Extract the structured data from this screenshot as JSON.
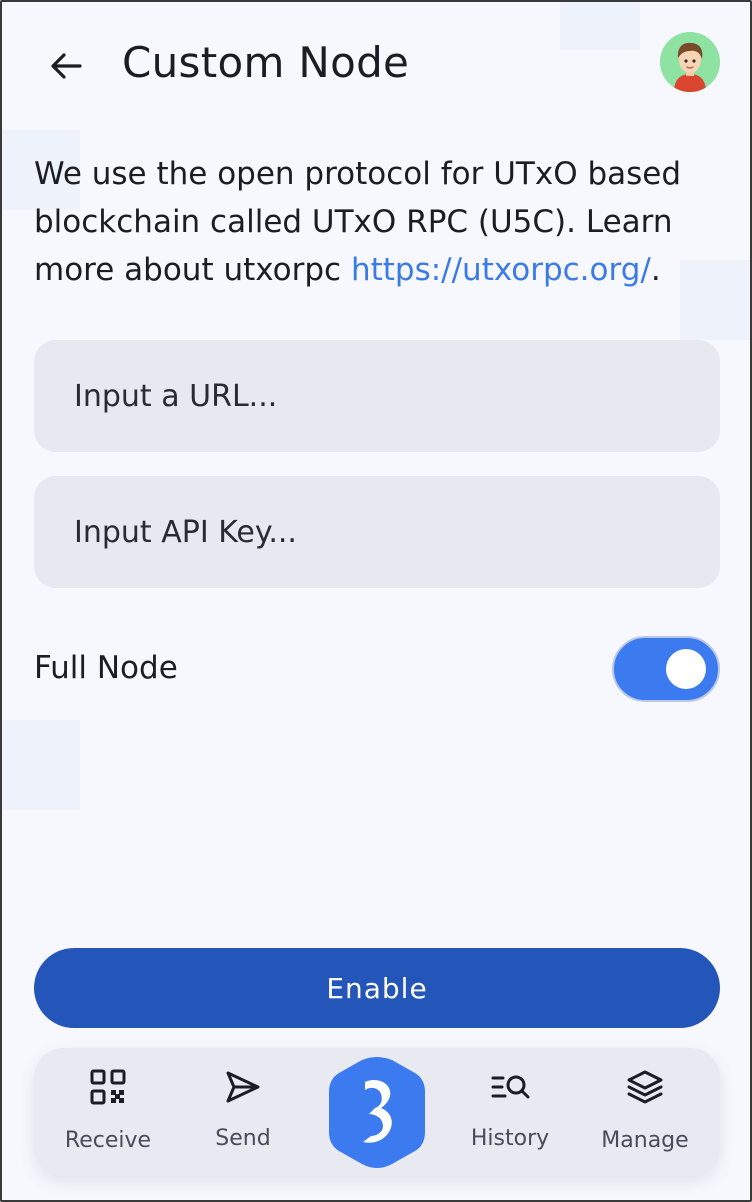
{
  "header": {
    "title": "Custom Node",
    "back_icon": "arrow-left-icon",
    "avatar_icon": "user-avatar-icon"
  },
  "intro": {
    "text": "We use the open protocol for UTxO based blockchain called UTxO RPC (U5C). Learn more about utxorpc ",
    "link": "https://utxorpc.org/",
    "suffix": "."
  },
  "fields": {
    "url_placeholder": "Input a URL...",
    "url_value": "",
    "api_key_placeholder": "Input API Key...",
    "api_key_value": ""
  },
  "full_node": {
    "label": "Full Node",
    "enabled": true
  },
  "enable_button": "Enable",
  "nav": {
    "receive": "Receive",
    "send": "Send",
    "history": "History",
    "manage": "Manage"
  },
  "colors": {
    "accent": "#3b7bef",
    "button": "#2455b8",
    "link": "#3b7be6"
  }
}
